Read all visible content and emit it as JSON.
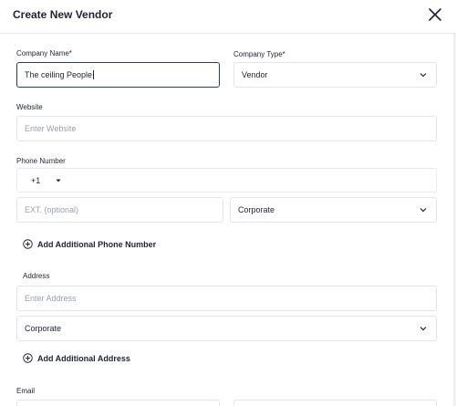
{
  "dialog": {
    "title": "Create New Vendor"
  },
  "company_name": {
    "label": "Company Name*",
    "value": "The ceiling People"
  },
  "company_type": {
    "label": "Company Type*",
    "value": "Vendor"
  },
  "website": {
    "label": "Website",
    "placeholder": "Enter Website"
  },
  "phone": {
    "label": "Phone Number",
    "country_code": "+1",
    "ext_placeholder": "EXT. (optional)",
    "type_value": "Corporate",
    "add_label": "Add Additional Phone Number"
  },
  "address": {
    "label": "Address",
    "placeholder": "Enter Address",
    "type_value": "Corporate",
    "add_label": "Add Additional Address"
  },
  "email": {
    "label": "Email"
  }
}
